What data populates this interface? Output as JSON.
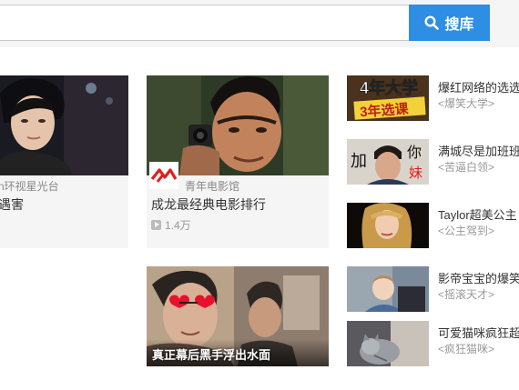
{
  "search": {
    "placeholder": "",
    "button_label": "搜库"
  },
  "cards": [
    {
      "source": "n环视星光台",
      "title": "遇害"
    },
    {
      "source": "青年电影馆",
      "title": "成龙最经典电影排行",
      "views": "1.4万"
    },
    {
      "title": "真正幕后黑手浮出水面"
    }
  ],
  "thumb_text": {
    "univ_top": "4年大学",
    "univ_bottom": "3年选课",
    "jia": "加",
    "ni": "你",
    "mei": "妹"
  },
  "side_list": [
    {
      "title": "爆红网络的选选",
      "subtitle": "<爆笑大学>"
    },
    {
      "title": "满城尽是加班班",
      "subtitle": "<苦逼白领>"
    },
    {
      "title": "Taylor超美公主",
      "subtitle": "<公主驾到>"
    },
    {
      "title": "影帝宝宝的爆笑",
      "subtitle": "<摇滚天才>"
    },
    {
      "title": "可爱猫咪疯狂超",
      "subtitle": "<疯狂猫咪>"
    }
  ]
}
